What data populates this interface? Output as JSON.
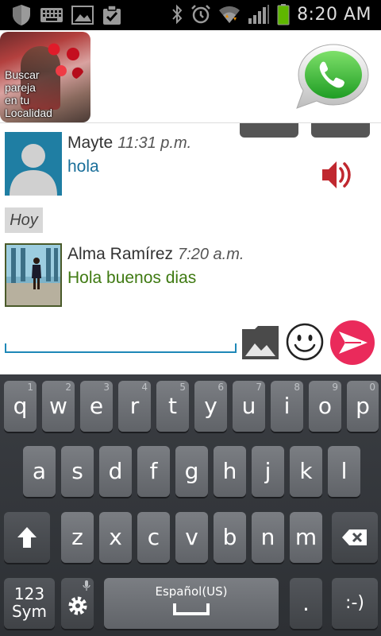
{
  "status_bar": {
    "time": "8:20 AM",
    "left_icons": [
      "shield-icon",
      "keyboard-icon",
      "image-icon",
      "clipboard-icon"
    ],
    "right_icons": [
      "bluetooth-icon",
      "alarm-icon",
      "wifi-icon",
      "signal-icon",
      "battery-icon"
    ]
  },
  "header": {
    "promo_lines": [
      "Buscar",
      "pareja",
      "en tu",
      "Localidad"
    ],
    "logo_icon": "whatsapp-logo-icon"
  },
  "messages": [
    {
      "sender": "Mayte",
      "time": "11:31 p.m.",
      "text": "hola",
      "text_color": "#1a6f9a"
    },
    {
      "sender": "Alma Ramírez",
      "time": "7:20 a.m.",
      "text": "Hola buenos dias",
      "text_color": "#3f7a12"
    }
  ],
  "day_separator": "Hoy",
  "composer": {
    "value": "",
    "placeholder": ""
  },
  "colors": {
    "accent": "#1e88b8",
    "send": "#ea2a5b",
    "speaker": "#c0282f"
  },
  "keyboard": {
    "row1": [
      {
        "k": "q",
        "h": "1"
      },
      {
        "k": "w",
        "h": "2"
      },
      {
        "k": "e",
        "h": "3"
      },
      {
        "k": "r",
        "h": "4"
      },
      {
        "k": "t",
        "h": "5"
      },
      {
        "k": "y",
        "h": "6"
      },
      {
        "k": "u",
        "h": "7"
      },
      {
        "k": "i",
        "h": "8"
      },
      {
        "k": "o",
        "h": "9"
      },
      {
        "k": "p",
        "h": "0"
      }
    ],
    "row2": [
      "a",
      "s",
      "d",
      "f",
      "g",
      "h",
      "j",
      "k",
      "l"
    ],
    "row3": [
      "z",
      "x",
      "c",
      "v",
      "b",
      "n",
      "m"
    ],
    "sym_label_1": "123",
    "sym_label_2": "Sym",
    "space_label": "Español(US)",
    "period": ".",
    "smiley": ":-)"
  }
}
